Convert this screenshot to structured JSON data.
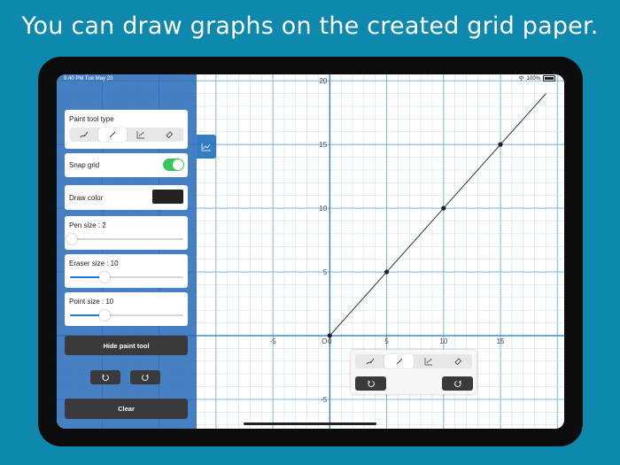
{
  "headline": "You can draw graphs on the created grid paper.",
  "status": {
    "time": "9:40 PM",
    "date": "Tue May 23",
    "battery": "100%"
  },
  "panel": {
    "paint_tool_type_label": "Paint tool type",
    "snap_grid_label": "Snap grid",
    "snap_grid_on": true,
    "draw_color_label": "Draw color",
    "draw_color": "#222222",
    "pen_size_label": "Pen size : 2",
    "pen_size": 2,
    "eraser_size_label": "Eraser size : 10",
    "eraser_size": 10,
    "point_size_label": "Point size : 10",
    "point_size": 10,
    "hide_button": "Hide paint tool",
    "clear_button": "Clear"
  },
  "tools": [
    "freehand-pen-icon",
    "line-icon",
    "scatter-icon",
    "eraser-icon"
  ],
  "active_tool": "line-icon",
  "colors": {
    "accent": "#1f7ae0",
    "toggle_on": "#35c759",
    "panel": "#1e64b4",
    "grid_major": "#6aaee0",
    "grid_minor": "#bfe0f8"
  },
  "chart_data": {
    "type": "line",
    "x_ticks": [
      -5,
      0,
      5,
      10,
      15
    ],
    "y_ticks": [
      -5,
      5,
      10,
      15,
      20
    ],
    "origin_label": "O",
    "xlim": [
      -24,
      20.6
    ],
    "ylim": [
      -7.3,
      20.5
    ],
    "series": [
      {
        "points": [
          [
            0,
            0
          ],
          [
            5,
            5
          ],
          [
            10,
            10
          ],
          [
            15,
            15
          ]
        ],
        "line_to": [
          19,
          19
        ]
      }
    ],
    "grid": true
  }
}
